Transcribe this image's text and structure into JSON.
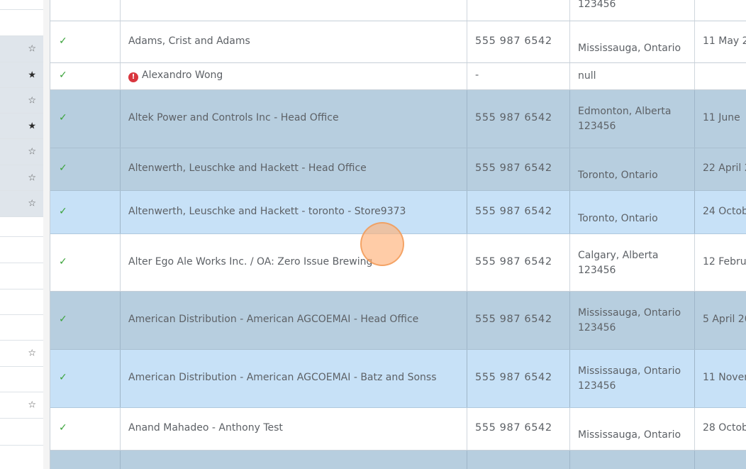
{
  "gutter": {
    "rows": [
      {
        "star": "",
        "shaded": false
      },
      {
        "star": "",
        "shaded": false
      },
      {
        "star": "☆",
        "shaded": true
      },
      {
        "star": "★",
        "shaded": true
      },
      {
        "star": "☆",
        "shaded": true
      },
      {
        "star": "★",
        "shaded": true
      },
      {
        "star": "☆",
        "shaded": true
      },
      {
        "star": "☆",
        "shaded": true
      },
      {
        "star": "☆",
        "shaded": true
      },
      {
        "star": "",
        "shaded": false
      },
      {
        "star": "",
        "shaded": false
      },
      {
        "star": "",
        "shaded": false
      },
      {
        "star": "",
        "shaded": false
      },
      {
        "star": "",
        "shaded": false
      },
      {
        "star": "☆",
        "shaded": false
      },
      {
        "star": "",
        "shaded": false
      },
      {
        "star": "☆",
        "shaded": false
      },
      {
        "star": "",
        "shaded": false
      }
    ]
  },
  "table": {
    "rows": [
      {
        "check": "",
        "alert": false,
        "name": "",
        "phone": "",
        "location": "123456",
        "date": ""
      },
      {
        "check": "✓",
        "alert": false,
        "name": "Adams, Crist and Adams",
        "phone": "555 987 6542",
        "location": "Mississauga, Ontario",
        "date": "11 May 2"
      },
      {
        "check": "✓",
        "alert": true,
        "name": "Alexandro Wong",
        "phone": "-",
        "location": "null",
        "date": ""
      },
      {
        "check": "✓",
        "alert": false,
        "name": "Altek Power and Controls Inc - Head Office",
        "phone": "555 987 6542",
        "location": "Edmonton, Alberta\n123456",
        "date": "11 June"
      },
      {
        "check": "✓",
        "alert": false,
        "name": "Altenwerth, Leuschke and Hackett - Head Office",
        "phone": "555 987 6542",
        "location": "Toronto, Ontario",
        "date": "22 April 2"
      },
      {
        "check": "✓",
        "alert": false,
        "name": "Altenwerth, Leuschke and Hackett - toronto - Store9373",
        "phone": "555 987 6542",
        "location": "Toronto, Ontario",
        "date": "24 Octob"
      },
      {
        "check": "✓",
        "alert": false,
        "name": "Alter Ego Ale Works Inc. / OA: Zero Issue Brewing",
        "phone": "555 987 6542",
        "location": "Calgary, Alberta\n123456",
        "date": "12 Febru"
      },
      {
        "check": "✓",
        "alert": false,
        "name": "American Distribution - American AGCOEMAI - Head Office",
        "phone": "555 987 6542",
        "location": "Mississauga, Ontario\n123456",
        "date": "5 April 20"
      },
      {
        "check": "✓",
        "alert": false,
        "name": "American Distribution - American AGCOEMAI - Batz and Sonss",
        "phone": "555 987 6542",
        "location": "Mississauga, Ontario\n123456",
        "date": "11 Nover"
      },
      {
        "check": "✓",
        "alert": false,
        "name": "Anand Mahadeo - Anthony Test",
        "phone": "555 987 6542",
        "location": "Mississauga, Ontario",
        "date": "28 Octob"
      },
      {
        "check": "",
        "alert": false,
        "name": "",
        "phone": "",
        "location": "",
        "date": ""
      }
    ]
  },
  "colors": {
    "row_dark": "#b7cedf",
    "row_light": "#c7e1f7",
    "check_green": "#3aa33a",
    "alert_red": "#d9363e"
  }
}
